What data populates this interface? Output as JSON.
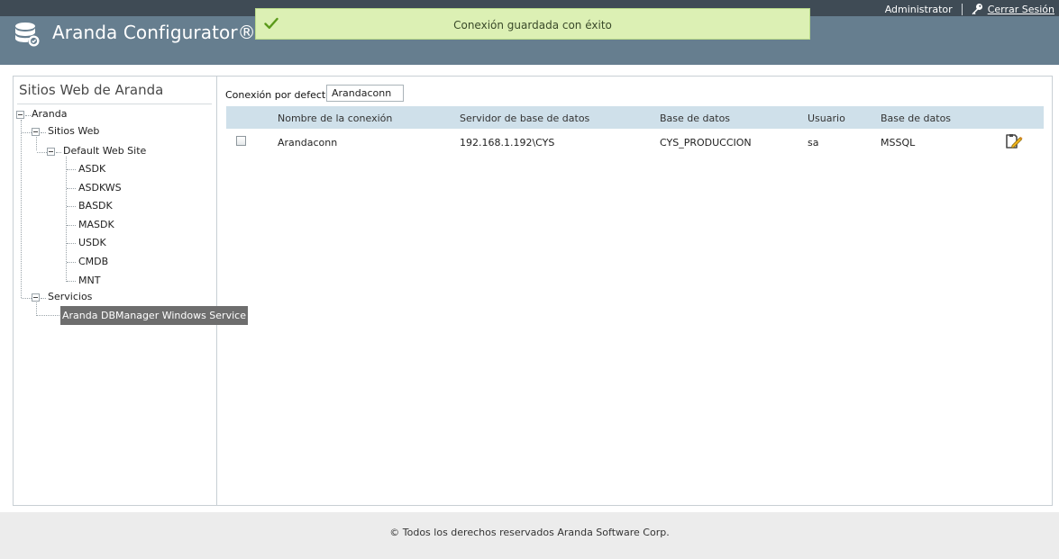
{
  "header": {
    "app_title": "Aranda Configurator®",
    "user_name": "Administrator",
    "logout_label": "Cerrar Sesión",
    "bg_color": "#667e8f",
    "topbar_color": "#3f4b55"
  },
  "notification": {
    "message": "Conexión guardada con éxito",
    "icon": "check-icon",
    "bg_color": "#dcf0b4"
  },
  "sidebar": {
    "title": "Sitios Web de Aranda",
    "tree": {
      "root": "Aranda",
      "sitios_web": "Sitios Web",
      "default_web_site": "Default Web Site",
      "sites": [
        "ASDK",
        "ASDKWS",
        "BASDK",
        "MASDK",
        "USDK",
        "CMDB",
        "MNT"
      ],
      "servicios": "Servicios",
      "service_selected": "Aranda DBManager Windows Service"
    }
  },
  "main": {
    "default_connection_label": "Conexión por defecto",
    "default_connection_value": "Arandaconn",
    "columns": [
      "Nombre de la conexión",
      "Servidor de base de datos",
      "Base de datos",
      "Usuario",
      "Base de datos"
    ],
    "rows": [
      {
        "checked": false,
        "name": "Arandaconn",
        "server": "192.168.1.192\\CYS",
        "database": "CYS_PRODUCCION",
        "user": "sa",
        "engine": "MSSQL"
      }
    ],
    "header_color": "#cfe0ea"
  },
  "footer": {
    "text": "© Todos los derechos reservados Aranda Software Corp."
  }
}
